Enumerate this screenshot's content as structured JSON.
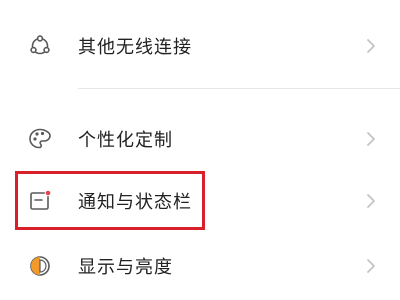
{
  "settings": {
    "items": [
      {
        "label": "其他无线连接",
        "icon": "wireless-connections-icon"
      },
      {
        "label": "个性化定制",
        "icon": "palette-icon"
      },
      {
        "label": "通知与状态栏",
        "icon": "notification-window-icon",
        "highlighted": true
      },
      {
        "label": "显示与亮度",
        "icon": "brightness-icon"
      }
    ],
    "chevron_icon": "chevron-right-icon"
  },
  "colors": {
    "accent": "#d9202a",
    "icon_stroke": "#5a5a5a",
    "brightness_orange": "#f39a2a",
    "notification_dot": "#e8434a",
    "chevron": "#c4c4c4",
    "divider": "#e6e6e6"
  }
}
